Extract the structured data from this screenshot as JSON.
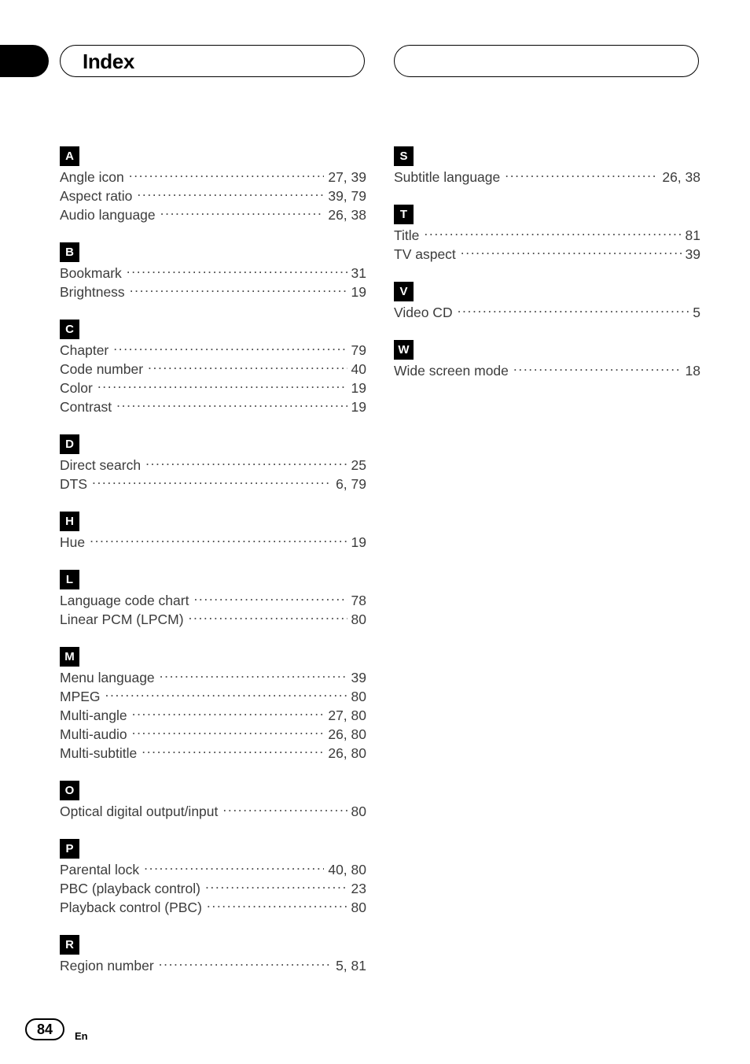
{
  "header": {
    "title": "Index",
    "tab_marker": "black-tab",
    "right_box_label": ""
  },
  "columns": {
    "left": [
      {
        "letter": "A",
        "entries": [
          {
            "label": "Angle icon",
            "page": "27, 39"
          },
          {
            "label": "Aspect ratio",
            "page": "39, 79"
          },
          {
            "label": "Audio language",
            "page": "26, 38"
          }
        ]
      },
      {
        "letter": "B",
        "entries": [
          {
            "label": "Bookmark",
            "page": "31"
          },
          {
            "label": "Brightness",
            "page": "19"
          }
        ]
      },
      {
        "letter": "C",
        "entries": [
          {
            "label": "Chapter",
            "page": "79"
          },
          {
            "label": "Code number",
            "page": "40"
          },
          {
            "label": "Color",
            "page": "19"
          },
          {
            "label": "Contrast",
            "page": "19"
          }
        ]
      },
      {
        "letter": "D",
        "entries": [
          {
            "label": "Direct search",
            "page": "25"
          },
          {
            "label": "DTS",
            "page": "6, 79"
          }
        ]
      },
      {
        "letter": "H",
        "entries": [
          {
            "label": "Hue",
            "page": "19"
          }
        ]
      },
      {
        "letter": "L",
        "entries": [
          {
            "label": "Language code chart",
            "page": "78"
          },
          {
            "label": "Linear PCM (LPCM)",
            "page": "80"
          }
        ]
      },
      {
        "letter": "M",
        "entries": [
          {
            "label": "Menu language",
            "page": "39"
          },
          {
            "label": "MPEG",
            "page": "80"
          },
          {
            "label": "Multi-angle",
            "page": "27, 80"
          },
          {
            "label": "Multi-audio",
            "page": "26, 80"
          },
          {
            "label": "Multi-subtitle",
            "page": "26, 80"
          }
        ]
      },
      {
        "letter": "O",
        "entries": [
          {
            "label": "Optical digital output/input",
            "page": "80"
          }
        ]
      },
      {
        "letter": "P",
        "entries": [
          {
            "label": "Parental lock",
            "page": "40, 80"
          },
          {
            "label": "PBC (playback control)",
            "page": "23"
          },
          {
            "label": "Playback control (PBC)",
            "page": "80"
          }
        ]
      },
      {
        "letter": "R",
        "entries": [
          {
            "label": "Region number",
            "page": "5, 81"
          }
        ]
      }
    ],
    "right": [
      {
        "letter": "S",
        "entries": [
          {
            "label": "Subtitle language",
            "page": "26, 38"
          }
        ]
      },
      {
        "letter": "T",
        "entries": [
          {
            "label": "Title",
            "page": "81"
          },
          {
            "label": "TV aspect",
            "page": "39"
          }
        ]
      },
      {
        "letter": "V",
        "entries": [
          {
            "label": "Video CD",
            "page": "5"
          }
        ]
      },
      {
        "letter": "W",
        "entries": [
          {
            "label": "Wide screen mode",
            "page": "18"
          }
        ]
      }
    ]
  },
  "footer": {
    "page_number": "84",
    "language_code": "En"
  },
  "colors": {
    "ink": "#1a1a1a",
    "entry_text": "#3c3c3c",
    "badge_bg": "#000000",
    "badge_text": "#ffffff",
    "page_bg": "#ffffff"
  }
}
